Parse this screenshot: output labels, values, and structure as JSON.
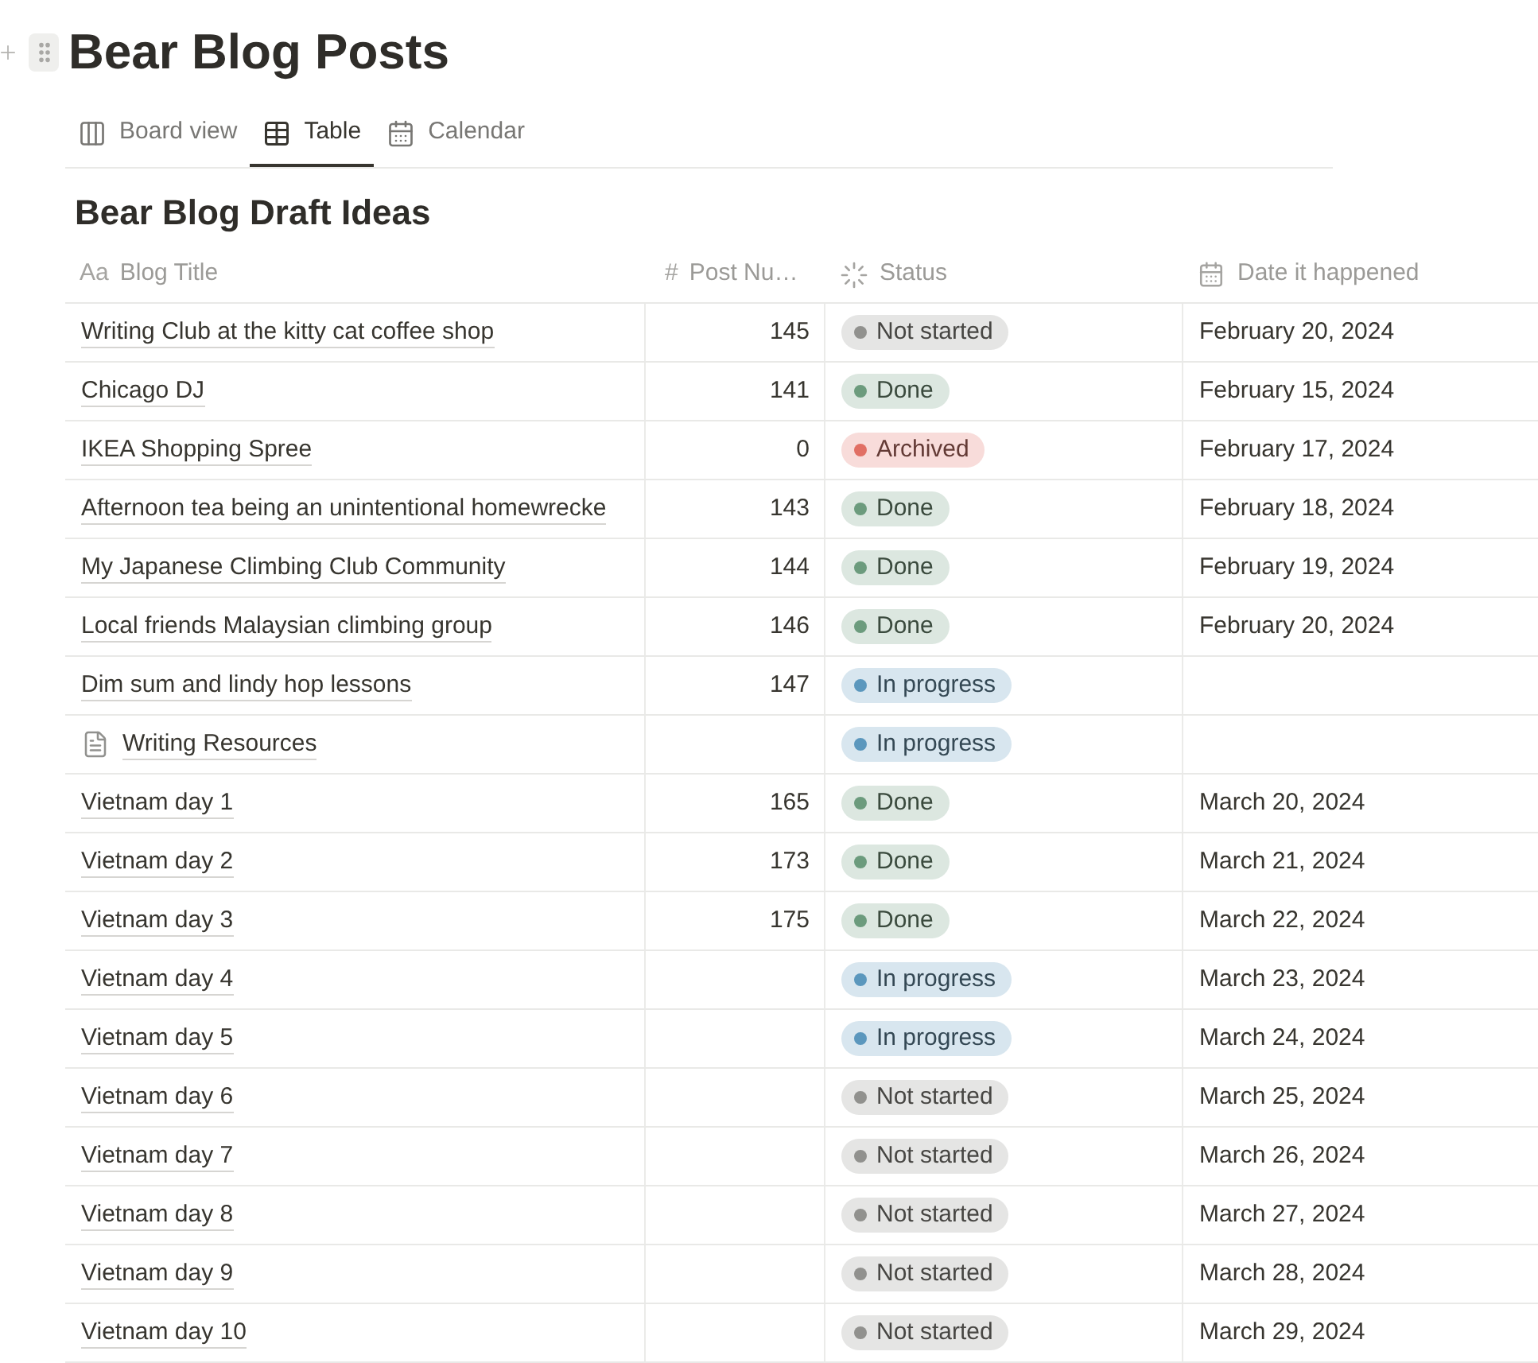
{
  "page": {
    "title": "Bear Blog Posts"
  },
  "tabs": [
    {
      "label": "Board view",
      "kind": "board",
      "selected": false
    },
    {
      "label": "Table",
      "kind": "table",
      "selected": true
    },
    {
      "label": "Calendar",
      "kind": "calendar",
      "selected": false
    }
  ],
  "table": {
    "title": "Bear Blog Draft Ideas",
    "columns": [
      {
        "kind": "title",
        "icon_text": "Aa",
        "label": "Blog Title"
      },
      {
        "kind": "number",
        "icon_text": "#",
        "label": "Post Nu…"
      },
      {
        "kind": "status",
        "label": "Status"
      },
      {
        "kind": "date",
        "label": "Date it happened"
      }
    ],
    "rows": [
      {
        "kind": "entry",
        "title": "Writing Club at the kitty cat coffee shop",
        "post_number": "145",
        "status": {
          "label": "Not started",
          "color": "#91918e"
        },
        "date": "February 20, 2024"
      },
      {
        "kind": "entry",
        "title": "Chicago DJ",
        "post_number": "141",
        "status": {
          "label": "Done",
          "color": "#6c9b7d"
        },
        "date": "February 15, 2024"
      },
      {
        "kind": "entry",
        "title": "IKEA Shopping Spree",
        "post_number": "0",
        "status": {
          "label": "Archived",
          "color": "#e16f64"
        },
        "date": "February 17, 2024"
      },
      {
        "kind": "entry",
        "title": "Afternoon tea being an unintentional homewrecke",
        "post_number": "143",
        "status": {
          "label": "Done",
          "color": "#6c9b7d"
        },
        "date": "February 18, 2024"
      },
      {
        "kind": "entry",
        "title": "My Japanese Climbing Club Community",
        "post_number": "144",
        "status": {
          "label": "Done",
          "color": "#6c9b7d"
        },
        "date": "February 19, 2024"
      },
      {
        "kind": "entry",
        "title": "Local friends Malaysian climbing group",
        "post_number": "146",
        "status": {
          "label": "Done",
          "color": "#6c9b7d"
        },
        "date": "February 20, 2024"
      },
      {
        "kind": "entry",
        "title": "Dim sum and lindy hop lessons",
        "post_number": "147",
        "status": {
          "label": "In progress",
          "color": "#5b97bd"
        }
      },
      {
        "kind": "page",
        "title": "Writing Resources",
        "status": {
          "label": "In progress",
          "color": "#5b97bd"
        }
      },
      {
        "kind": "entry",
        "title": "Vietnam day 1",
        "post_number": "165",
        "status": {
          "label": "Done",
          "color": "#6c9b7d"
        },
        "date": "March 20, 2024"
      },
      {
        "kind": "entry",
        "title": "Vietnam day 2",
        "post_number": "173",
        "status": {
          "label": "Done",
          "color": "#6c9b7d"
        },
        "date": "March 21, 2024"
      },
      {
        "kind": "entry",
        "title": "Vietnam day 3",
        "post_number": "175",
        "status": {
          "label": "Done",
          "color": "#6c9b7d"
        },
        "date": "March 22, 2024"
      },
      {
        "kind": "entry",
        "title": "Vietnam day 4",
        "status": {
          "label": "In progress",
          "color": "#5b97bd"
        },
        "date": "March 23, 2024"
      },
      {
        "kind": "entry",
        "title": "Vietnam day 5",
        "status": {
          "label": "In progress",
          "color": "#5b97bd"
        },
        "date": "March 24, 2024"
      },
      {
        "kind": "entry",
        "title": "Vietnam day 6",
        "status": {
          "label": "Not started",
          "color": "#91918e"
        },
        "date": "March 25, 2024"
      },
      {
        "kind": "entry",
        "title": "Vietnam day 7",
        "status": {
          "label": "Not started",
          "color": "#91918e"
        },
        "date": "March 26, 2024"
      },
      {
        "kind": "entry",
        "title": "Vietnam day 8",
        "status": {
          "label": "Not started",
          "color": "#91918e"
        },
        "date": "March 27, 2024"
      },
      {
        "kind": "entry",
        "title": "Vietnam day 9",
        "status": {
          "label": "Not started",
          "color": "#91918e"
        },
        "date": "March 28, 2024"
      },
      {
        "kind": "entry",
        "title": "Vietnam day 10",
        "status": {
          "label": "Not started",
          "color": "#91918e"
        },
        "date": "March 29, 2024"
      }
    ]
  }
}
